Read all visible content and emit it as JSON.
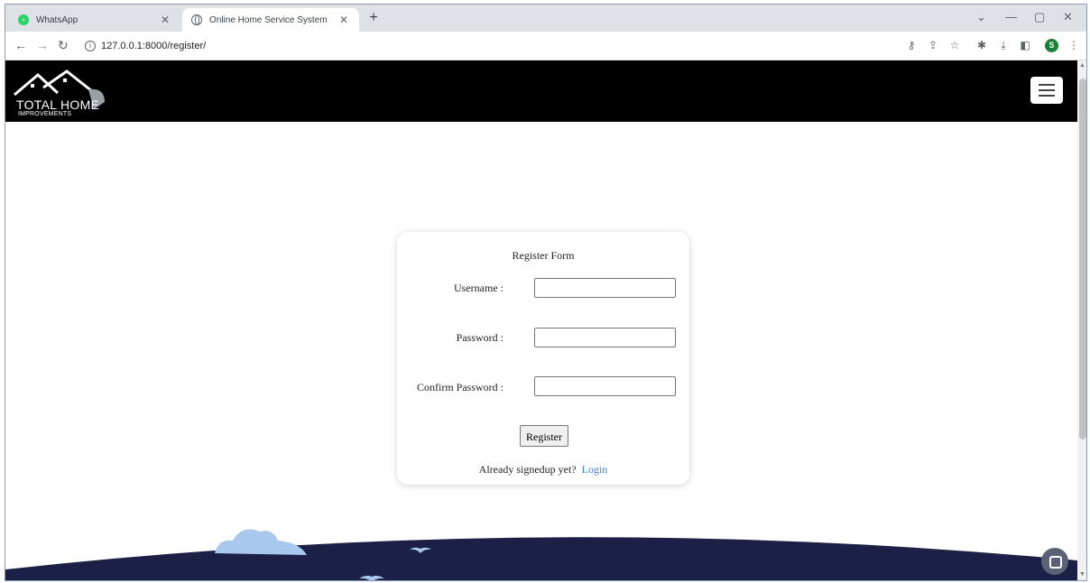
{
  "browser": {
    "tabs": [
      {
        "title": "WhatsApp",
        "favicon": "whatsapp-icon",
        "active": false
      },
      {
        "title": "Online Home Service System",
        "favicon": "globe-icon",
        "active": true
      }
    ],
    "url": "127.0.0.1:8000/register/",
    "profile_initial": "S"
  },
  "site": {
    "logo_main": "TOTAL HOME",
    "logo_sub": "IMPROVEMENTS"
  },
  "form": {
    "title": "Register Form",
    "username_label": "Username :",
    "password_label": "Password :",
    "confirm_label": "Confirm Password :",
    "username_value": "",
    "password_value": "",
    "confirm_value": "",
    "submit_label": "Register",
    "footer_text": "Already signedup yet?",
    "footer_link": "Login"
  },
  "colors": {
    "header_bg": "#000000",
    "scenery_navy": "#1c2046",
    "cloud": "#a9c8ee",
    "link": "#3b7dd8"
  }
}
